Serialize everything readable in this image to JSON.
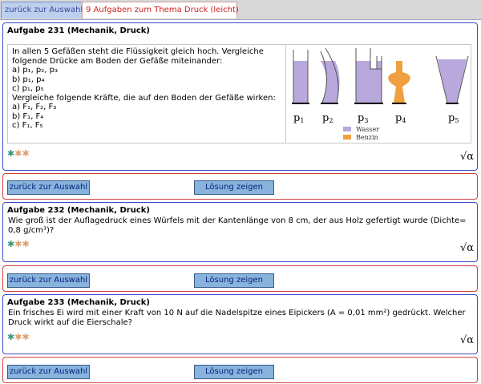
{
  "tabs": {
    "back": "zurück zur Auswahl",
    "current": "9 Aufgaben zum Thema Druck (leicht)"
  },
  "tasks": [
    {
      "title": "Aufgabe 231 (Mechanik, Druck)",
      "lines": [
        "In allen 5 Gefäßen steht die Flüssigkeit gleich hoch. Vergleiche",
        "folgende Drücke am Boden der Gefäße miteinander:",
        "a) p₁, p₂, p₃",
        "b) p₁, p₄",
        "c) p₁, p₅",
        "Vergleiche folgende Kräfte, die auf den Boden der Gefäße wirken:",
        "a) F₁, F₂, F₃",
        "b) F₁, F₄",
        "c) F₁, F₅"
      ],
      "figure": {
        "labels": [
          "p",
          "p",
          "p",
          "p",
          "p"
        ],
        "subs": [
          "1",
          "2",
          "3",
          "4",
          "5"
        ],
        "legend_water": "Wasser",
        "legend_petrol": "Benzin",
        "water_color": "#b8a8dc",
        "petrol_color": "#f0a040"
      }
    },
    {
      "title": "Aufgabe 232 (Mechanik, Druck)",
      "text": "Wie groß ist der Auflagedruck eines Würfels mit der Kantenlänge von 8 cm, der aus Holz gefertigt wurde (Dichte= 0,8 g/cm³)?"
    },
    {
      "title": "Aufgabe 233 (Mechanik, Druck)",
      "text": "Ein frisches Ei wird mit einer Kraft von 10 N auf die Nadelspitze eines Eipickers (A = 0,01 mm²) gedrückt. Welcher Druck wirkt auf die Eierschale?"
    }
  ],
  "difficulty": {
    "stars": [
      "✱",
      "✱",
      "✱"
    ],
    "colors": [
      "#3a9a70",
      "#e0a070",
      "#e0a070"
    ]
  },
  "sqrt_symbol": "√α",
  "buttons": {
    "back": "zurück zur Auswahl",
    "solution": "Lösung zeigen"
  }
}
